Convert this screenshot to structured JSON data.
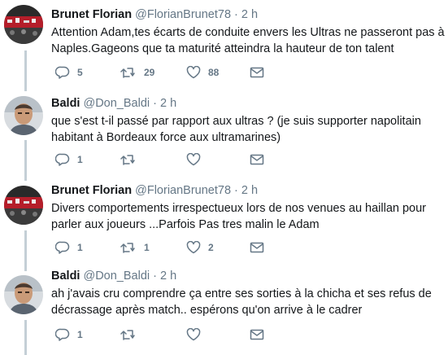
{
  "tweets": [
    {
      "name": "Brunet Florian",
      "handle": "@FlorianBrunet78",
      "time": "2 h",
      "lines": [
        "Attention Adam,tes écarts de conduite envers les Ultras ne passeront pas à",
        "Naples.Gageons que ta maturité atteindra la hauteur de ton talent"
      ],
      "replies": "5",
      "retweets": "29",
      "likes": "88"
    },
    {
      "name": "Baldi",
      "handle": "@Don_Baldi",
      "time": "2 h",
      "lines": [
        "que s'est t-il passé par rapport aux ultras ? (je suis supporter napolitain",
        "habitant à Bordeaux force aux ultramarines)"
      ],
      "replies": "1",
      "retweets": "",
      "likes": ""
    },
    {
      "name": "Brunet Florian",
      "handle": "@FlorianBrunet78",
      "time": "2 h",
      "lines": [
        "Divers comportements irrespectueux lors de nos venues au haillan pour",
        "parler aux joueurs ...Parfois Pas tres malin le Adam"
      ],
      "replies": "1",
      "retweets": "1",
      "likes": "2"
    },
    {
      "name": "Baldi",
      "handle": "@Don_Baldi",
      "time": "2 h",
      "lines": [
        "ah j'avais cru comprendre ça entre ses sorties à la chicha et ses refus de",
        "décrassage après match.. espérons qu'on arrive à le cadrer"
      ],
      "replies": "1",
      "retweets": "",
      "likes": ""
    }
  ],
  "ui": {
    "dot": "·"
  },
  "colors": {
    "text": "#14171a",
    "muted": "#657786",
    "thread_line": "#c4cfd6"
  },
  "icons": [
    "reply-icon",
    "retweet-icon",
    "like-icon",
    "message-icon"
  ]
}
